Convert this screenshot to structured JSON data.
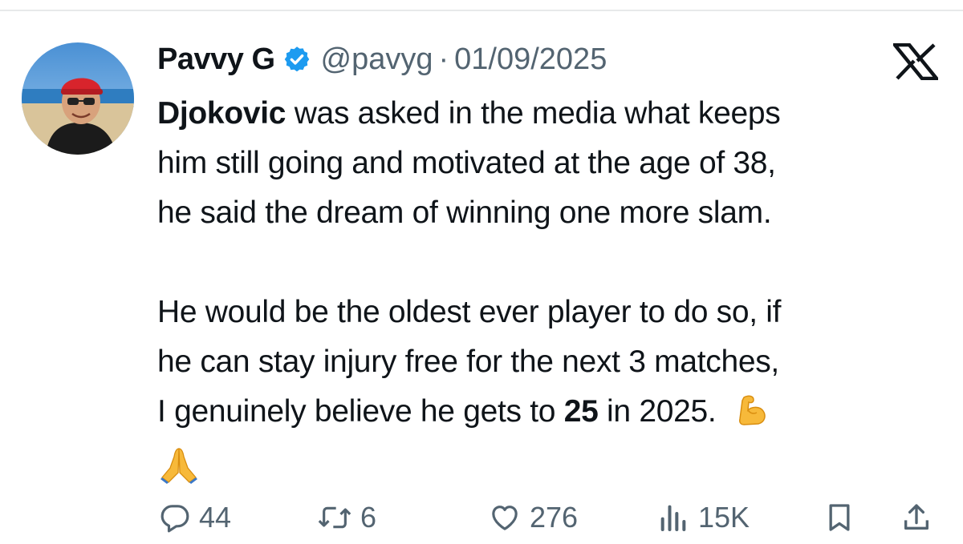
{
  "author": {
    "display_name": "Pavvy G",
    "handle": "@pavyg",
    "separator": "·",
    "date": "01/09/2025",
    "verified": true,
    "avatar_icon": "profile-photo"
  },
  "platform_icon": "x-logo-icon",
  "tweet": {
    "para1_bold": "Djokovic",
    "para1_line1_rest": " was asked in the media what keeps",
    "para1_line2": "him still going and motivated at the age of 38,",
    "para1_line3": "he said the dream of winning one more slam.",
    "para2_line1": "He would be the oldest ever player to do so, if",
    "para2_line2": "he can stay injury free for the next 3 matches,",
    "para2_line3_pre": "I genuinely believe he gets to ",
    "para2_line3_bold": "25",
    "para2_line3_post": " in 2025.",
    "emojis": [
      "flexed-biceps-emoji",
      "folded-hands-emoji"
    ]
  },
  "actions": {
    "replies": "44",
    "reposts": "6",
    "likes": "276",
    "views": "15K",
    "icons": [
      "reply-icon",
      "repost-icon",
      "like-icon",
      "views-icon",
      "bookmark-icon",
      "share-icon"
    ]
  },
  "colors": {
    "text": "#0f1419",
    "secondary": "#536471",
    "verified": "#1d9bf0",
    "divider": "#e7e9ea"
  }
}
